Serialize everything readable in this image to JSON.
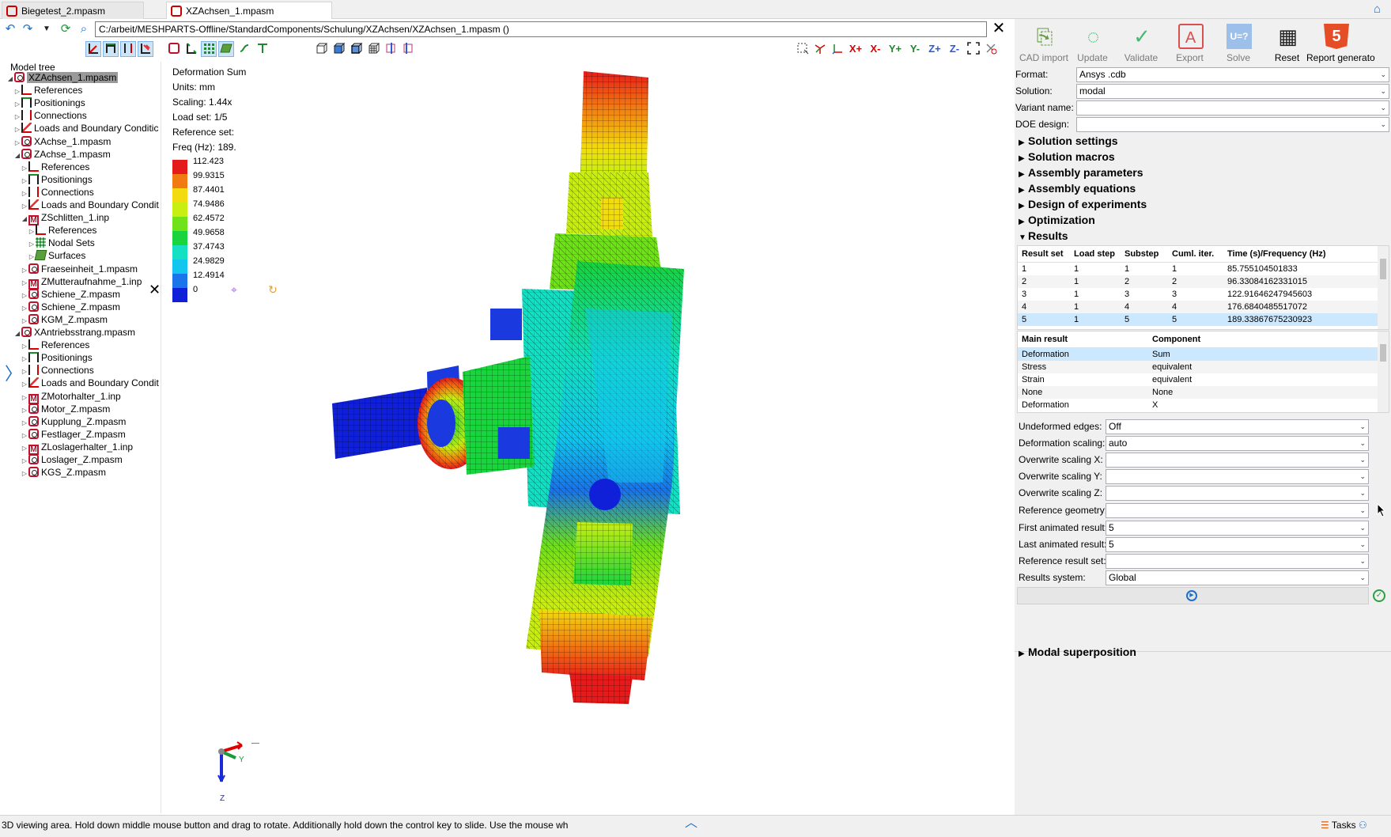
{
  "tabs": [
    {
      "label": "Biegetest_2.mpasm",
      "active": false
    },
    {
      "label": "XZAchsen_1.mpasm",
      "active": true
    }
  ],
  "nav": {
    "path": "C:/arbeit/MESHPARTS-Offline/StandardComponents/Schulung/XZAchsen/XZAchsen_1.mpasm ()"
  },
  "tree": {
    "header": "Model tree",
    "items": [
      {
        "label": "XZAchsen_1.mpasm",
        "level": 0,
        "icon": "assembly-icon",
        "expanded": true,
        "selected": true
      },
      {
        "label": "References",
        "level": 1,
        "icon": "references-icon"
      },
      {
        "label": "Positionings",
        "level": 1,
        "icon": "positionings-icon"
      },
      {
        "label": "Connections",
        "level": 1,
        "icon": "connections-icon"
      },
      {
        "label": "Loads and Boundary Conditic",
        "level": 1,
        "icon": "loads-icon"
      },
      {
        "label": "XAchse_1.mpasm",
        "level": 1,
        "icon": "assembly-icon"
      },
      {
        "label": "ZAchse_1.mpasm",
        "level": 1,
        "icon": "assembly-icon",
        "expanded": true
      },
      {
        "label": "References",
        "level": 2,
        "icon": "references-icon"
      },
      {
        "label": "Positionings",
        "level": 2,
        "icon": "positionings-icon"
      },
      {
        "label": "Connections",
        "level": 2,
        "icon": "connections-icon"
      },
      {
        "label": "Loads and Boundary Condit",
        "level": 2,
        "icon": "loads-icon"
      },
      {
        "label": "ZSchlitten_1.inp",
        "level": 2,
        "icon": "inp-icon",
        "expanded": true
      },
      {
        "label": "References",
        "level": 3,
        "icon": "references-icon"
      },
      {
        "label": "Nodal Sets",
        "level": 3,
        "icon": "nodal-sets-icon"
      },
      {
        "label": "Surfaces",
        "level": 3,
        "icon": "surfaces-icon"
      },
      {
        "label": "Fraeseinheit_1.mpasm",
        "level": 2,
        "icon": "assembly-icon"
      },
      {
        "label": "ZMutteraufnahme_1.inp",
        "level": 2,
        "icon": "inp-icon"
      },
      {
        "label": "Schiene_Z.mpasm",
        "level": 2,
        "icon": "assembly-icon"
      },
      {
        "label": "Schiene_Z.mpasm",
        "level": 2,
        "icon": "assembly-icon"
      },
      {
        "label": "KGM_Z.mpasm",
        "level": 2,
        "icon": "assembly-icon"
      },
      {
        "label": "XAntriebsstrang.mpasm",
        "level": 1,
        "icon": "assembly-icon",
        "expanded": true
      },
      {
        "label": "References",
        "level": 2,
        "icon": "references-icon"
      },
      {
        "label": "Positionings",
        "level": 2,
        "icon": "positionings-icon"
      },
      {
        "label": "Connections",
        "level": 2,
        "icon": "connections-icon"
      },
      {
        "label": "Loads and Boundary Condit",
        "level": 2,
        "icon": "loads-icon"
      },
      {
        "label": "ZMotorhalter_1.inp",
        "level": 2,
        "icon": "inp-icon"
      },
      {
        "label": "Motor_Z.mpasm",
        "level": 2,
        "icon": "assembly-icon"
      },
      {
        "label": "Kupplung_Z.mpasm",
        "level": 2,
        "icon": "assembly-icon"
      },
      {
        "label": "Festlager_Z.mpasm",
        "level": 2,
        "icon": "assembly-icon"
      },
      {
        "label": "ZLoslagerhalter_1.inp",
        "level": 2,
        "icon": "inp-icon"
      },
      {
        "label": "Loslager_Z.mpasm",
        "level": 2,
        "icon": "assembly-icon"
      },
      {
        "label": "KGS_Z.mpasm",
        "level": 2,
        "icon": "assembly-icon"
      }
    ]
  },
  "legend": {
    "title": "Deformation Sum",
    "units": "Units: mm",
    "scaling": "Scaling: 1.44x",
    "load_set": "Load set: 1/5",
    "reference_set": "Reference set:",
    "freq": "Freq (Hz): 189.",
    "entries": [
      {
        "value": "112.423",
        "color": "#e51b1b"
      },
      {
        "value": "99.9315",
        "color": "#f27a12"
      },
      {
        "value": "87.4401",
        "color": "#f2dc10"
      },
      {
        "value": "74.9486",
        "color": "#c8ee12"
      },
      {
        "value": "62.4572",
        "color": "#6fe21a"
      },
      {
        "value": "49.9658",
        "color": "#19d43c"
      },
      {
        "value": "37.4743",
        "color": "#14e0c4"
      },
      {
        "value": "24.9829",
        "color": "#12c6ee"
      },
      {
        "value": "12.4914",
        "color": "#1a74ea"
      },
      {
        "value": "0",
        "color": "#1020d8"
      }
    ]
  },
  "axis_labels": {
    "y": "Y",
    "z": "Z"
  },
  "ribbon": [
    {
      "label": "CAD import",
      "icon": "cad-import-icon",
      "enabled": false
    },
    {
      "label": "Update",
      "icon": "update-icon",
      "enabled": false
    },
    {
      "label": "Validate",
      "icon": "validate-icon",
      "enabled": false
    },
    {
      "label": "Export",
      "icon": "export-icon",
      "enabled": false
    },
    {
      "label": "Solve",
      "icon": "solve-icon",
      "enabled": false
    },
    {
      "label": "Reset",
      "icon": "reset-icon",
      "enabled": true
    },
    {
      "label": "Report generato",
      "icon": "html5-icon",
      "enabled": true
    }
  ],
  "form": {
    "format": {
      "label": "Format:",
      "value": "Ansys .cdb"
    },
    "solution": {
      "label": "Solution:",
      "value": "modal"
    },
    "variant": {
      "label": "Variant name:",
      "value": ""
    },
    "doe": {
      "label": "DOE design:",
      "value": ""
    }
  },
  "sections": {
    "solution_settings": "Solution settings",
    "solution_macros": "Solution macros",
    "assembly_parameters": "Assembly parameters",
    "assembly_equations": "Assembly equations",
    "design_of_experiments": "Design of experiments",
    "optimization": "Optimization",
    "results": "Results",
    "modal_superposition": "Modal superposition"
  },
  "results_table": {
    "headers": [
      "Result set",
      "Load step",
      "Substep",
      "Cuml. iter.",
      "Time (s)/Frequency (Hz)"
    ],
    "rows": [
      [
        "1",
        "1",
        "1",
        "1",
        "85.755104501833"
      ],
      [
        "2",
        "1",
        "2",
        "2",
        "96.33084162331015"
      ],
      [
        "3",
        "1",
        "3",
        "3",
        "122.91646247945603"
      ],
      [
        "4",
        "1",
        "4",
        "4",
        "176.6840485517072"
      ],
      [
        "5",
        "1",
        "5",
        "5",
        "189.33867675230923"
      ]
    ],
    "selected_row": 4
  },
  "main_result_table": {
    "headers": [
      "Main result",
      "Component"
    ],
    "rows": [
      [
        "Deformation",
        "Sum"
      ],
      [
        "Stress",
        "equivalent"
      ],
      [
        "Strain",
        "equivalent"
      ],
      [
        "None",
        "None"
      ],
      [
        "Deformation",
        "X"
      ]
    ],
    "selected_row": 0
  },
  "post": {
    "undeformed_edges": {
      "label": "Undeformed edges:",
      "value": "Off"
    },
    "deformation_scaling": {
      "label": "Deformation scaling:",
      "value": "auto"
    },
    "overwrite_x": {
      "label": "Overwrite scaling X:",
      "value": ""
    },
    "overwrite_y": {
      "label": "Overwrite scaling Y:",
      "value": ""
    },
    "overwrite_z": {
      "label": "Overwrite scaling Z:",
      "value": ""
    },
    "reference_geometry": {
      "label": "Reference geometry:",
      "value": ""
    },
    "first_animated": {
      "label": "First animated result:",
      "value": "5"
    },
    "last_animated": {
      "label": "Last animated result:",
      "value": "5"
    },
    "reference_result_set": {
      "label": "Reference result set:",
      "value": ""
    },
    "results_system": {
      "label": "Results system:",
      "value": "Global"
    }
  },
  "status": {
    "text": "3D viewing area. Hold down middle mouse button and drag to rotate. Additionally hold down the control key to slide. Use the mouse wh",
    "tasks": "Tasks"
  },
  "colors": {
    "accent": "#1e6fc8",
    "selection": "#cce8ff",
    "panel": "#f0f0f0"
  }
}
